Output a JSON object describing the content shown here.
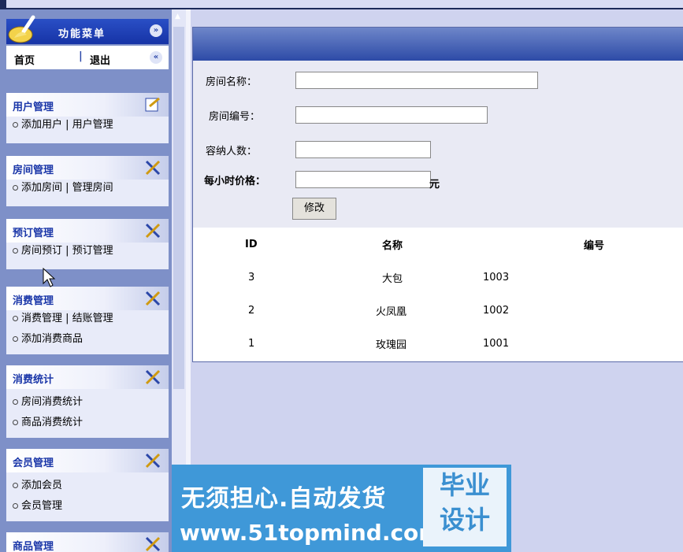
{
  "sidebar": {
    "menu_title": "功能菜单",
    "links": [
      "首页",
      "退出"
    ],
    "groups": [
      {
        "title": "用户管理",
        "rows": [
          "添加用户 | 用户管理"
        ]
      },
      {
        "title": "房间管理",
        "rows": [
          "添加房间 | 管理房间"
        ]
      },
      {
        "title": "预订管理",
        "rows": [
          "房间预订 | 预订管理"
        ]
      },
      {
        "title": "消费管理",
        "rows": [
          "消费管理 | 结账管理",
          "添加消费商品"
        ]
      },
      {
        "title": "消费统计",
        "rows": [
          "房间消费统计",
          "商品消费统计"
        ]
      },
      {
        "title": "会员管理",
        "rows": [
          "添加会员",
          "会员管理"
        ]
      },
      {
        "title": "商品管理",
        "rows": []
      }
    ]
  },
  "form": {
    "room_name_label": "房间名称：",
    "room_no_label": "房间编号：",
    "capacity_label": "容纳人数：",
    "price_label": "每小时价格：",
    "unit": "元",
    "submit": "修改"
  },
  "table": {
    "headers": [
      "ID",
      "名称",
      "编号"
    ],
    "rows": [
      {
        "id": "3",
        "name": "大包",
        "no": "1003"
      },
      {
        "id": "2",
        "name": "火凤凰",
        "no": "1002"
      },
      {
        "id": "1",
        "name": "玫瑰园",
        "no": "1001"
      }
    ]
  },
  "watermark": {
    "line1": "无须担心.自动发货",
    "line2": "www.51topmind.com",
    "badge1": "毕业",
    "badge2": "设计"
  }
}
